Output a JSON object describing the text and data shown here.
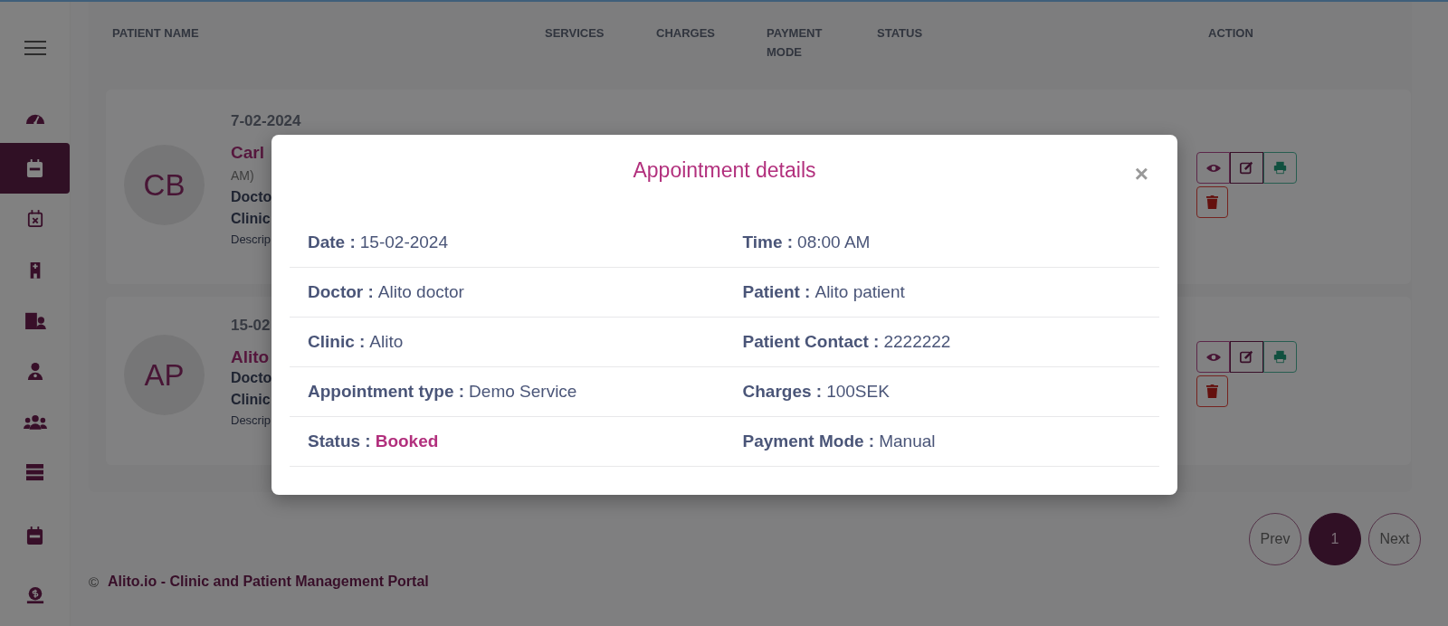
{
  "sidebar": {
    "items": [
      {
        "kind": "gauge",
        "selected": false
      },
      {
        "kind": "calendar",
        "selected": true
      },
      {
        "kind": "calendar-x",
        "selected": false
      },
      {
        "kind": "hospital",
        "selected": false
      },
      {
        "kind": "building-user",
        "selected": false
      },
      {
        "kind": "doctor",
        "selected": false
      },
      {
        "kind": "users",
        "selected": false
      },
      {
        "kind": "list",
        "selected": false
      },
      {
        "kind": "calendar",
        "selected": false
      },
      {
        "kind": "money",
        "selected": false
      }
    ]
  },
  "table": {
    "columns": [
      "PATIENT NAME",
      "SERVICES",
      "CHARGES",
      "PAYMENT MODE",
      "STATUS",
      "ACTION"
    ],
    "rows": [
      {
        "initials": "CB",
        "date": "7-02-2024",
        "lines": [
          {
            "kind": "name",
            "text": "Carl"
          },
          {
            "kind": "small",
            "text": "AM)"
          },
          {
            "kind": "bold",
            "text": "Docto"
          },
          {
            "kind": "bold",
            "text": "Clinic"
          },
          {
            "kind": "desc",
            "text": "Descrip"
          }
        ]
      },
      {
        "initials": "AP",
        "date": "15-02",
        "lines": [
          {
            "kind": "name",
            "text": "Alito"
          },
          {
            "kind": "bold",
            "text": "Docto"
          },
          {
            "kind": "bold",
            "text": "Clinic"
          },
          {
            "kind": "desc",
            "text": "Descrip"
          }
        ]
      }
    ]
  },
  "pagination": {
    "prev": "Prev",
    "pages": [
      {
        "label": "1",
        "selected": true
      }
    ],
    "next": "Next"
  },
  "footer": {
    "symbol": "©",
    "text": "Alito.io - Clinic and Patient Management Portal"
  },
  "modal": {
    "title": "Appointment details",
    "close": "×",
    "fields": [
      {
        "label": "Date :",
        "value": "15-02-2024",
        "kind": "plain"
      },
      {
        "label": "Time :",
        "value": "08:00 AM",
        "kind": "plain"
      },
      {
        "label": "Doctor :",
        "value": "Alito doctor",
        "kind": "plain"
      },
      {
        "label": "Patient :",
        "value": "Alito patient",
        "kind": "plain"
      },
      {
        "label": "Clinic :",
        "value": "Alito",
        "kind": "plain"
      },
      {
        "label": "Patient Contact :",
        "value": "2222222",
        "kind": "plain"
      },
      {
        "label": "Appointment type :",
        "value": "Demo Service",
        "kind": "plain"
      },
      {
        "label": "Charges :",
        "value": "100SEK",
        "kind": "plain"
      },
      {
        "label": "Status :",
        "value": "Booked",
        "kind": "status"
      },
      {
        "label": "Payment Mode :",
        "value": "Manual",
        "kind": "plain"
      }
    ]
  }
}
